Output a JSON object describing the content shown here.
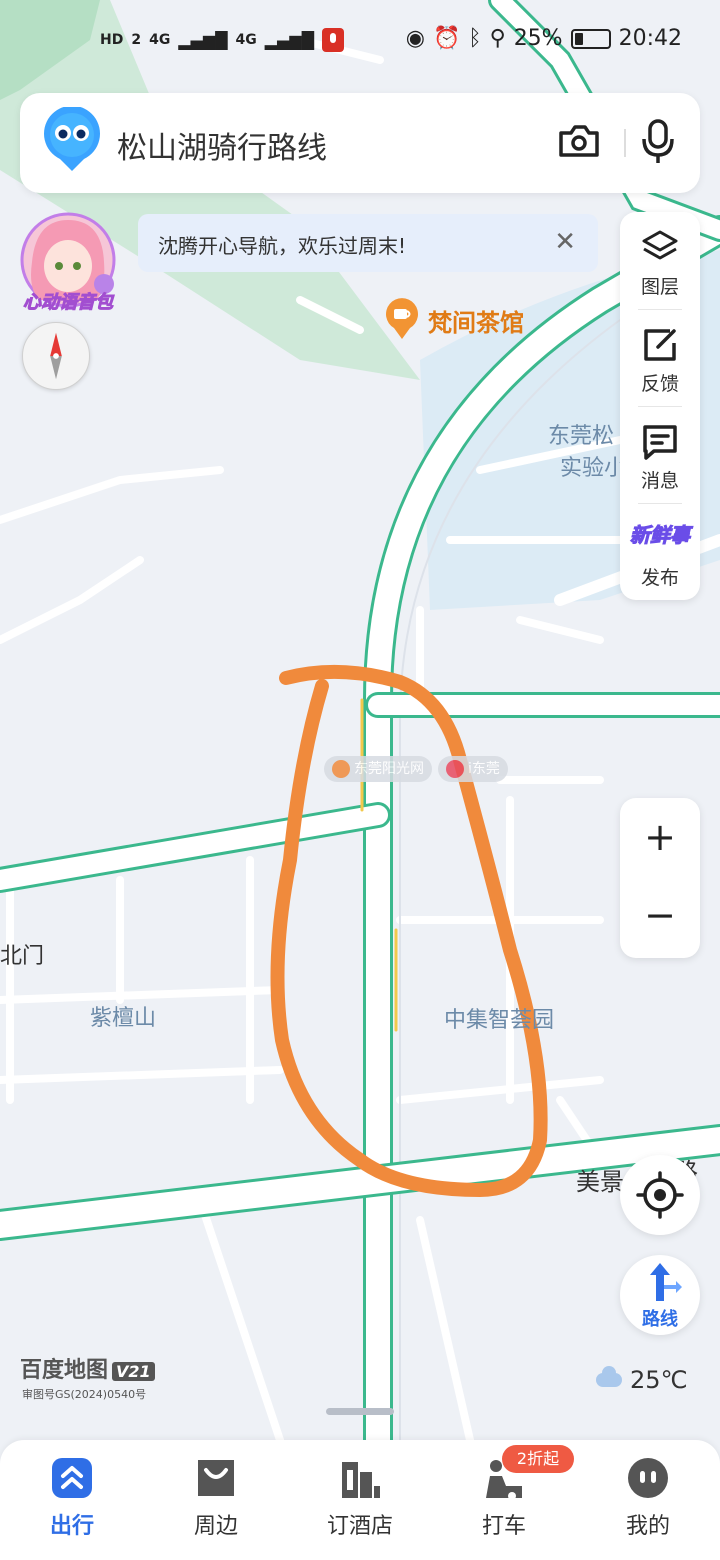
{
  "status_bar": {
    "left_items": [
      "HD",
      "2",
      "4G",
      "4G"
    ],
    "battery": "25%",
    "time": "20:42"
  },
  "search": {
    "query": "松山湖骑行路线"
  },
  "avatar": {
    "label": "心动语音包"
  },
  "notice": {
    "text": "沈腾开心导航，欢乐过周末!",
    "close": "✕"
  },
  "right_panel": {
    "items": [
      {
        "label": "图层",
        "icon": "layers-icon"
      },
      {
        "label": "反馈",
        "icon": "feedback-icon"
      },
      {
        "label": "消息",
        "icon": "message-icon"
      },
      {
        "label": "发布",
        "icon": "fresh-news-icon",
        "badge": "新鲜事"
      }
    ]
  },
  "zoom": {
    "in": "+",
    "out": "−"
  },
  "route_button": {
    "label": "路线"
  },
  "map": {
    "poi": "梵间茶馆",
    "labels": {
      "ziTanShan": "紫檀山",
      "zhongJi": "中集智荟园",
      "dongguan_1": "东莞松",
      "dongguan_2": "实验小",
      "beimen": "北门",
      "meijing": "美景",
      "lu": "路"
    },
    "watermark": [
      "东莞阳光网",
      "i东莞"
    ]
  },
  "logo": {
    "name": "百度地图",
    "version": "V21",
    "license": "审图号GS(2024)0540号"
  },
  "weather": {
    "temp": "25℃"
  },
  "tabs": [
    {
      "label": "出行",
      "active": true
    },
    {
      "label": "周边",
      "active": false
    },
    {
      "label": "订酒店",
      "active": false
    },
    {
      "label": "打车",
      "active": false
    },
    {
      "label": "我的",
      "active": false
    }
  ],
  "promo": {
    "line2": "2折起"
  },
  "colors": {
    "accent": "#2f6ee6",
    "road_green": "#3bb88d",
    "drawing": "#f08a3c",
    "map_bg": "#eef1f6"
  }
}
